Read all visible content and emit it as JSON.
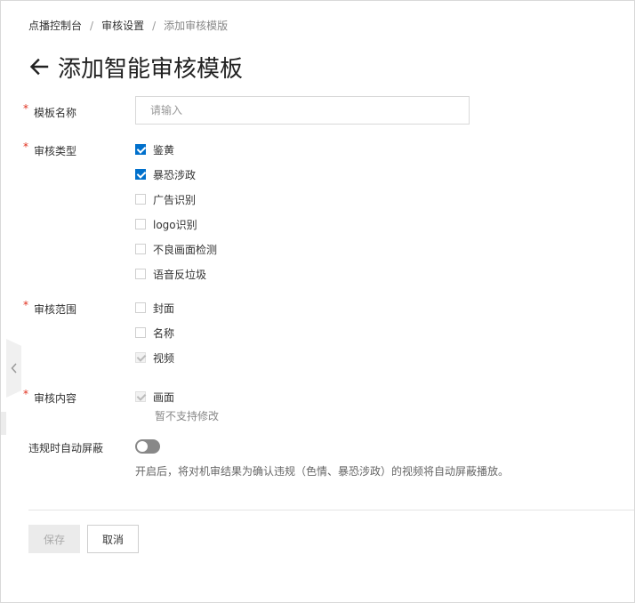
{
  "breadcrumb": {
    "items": [
      "点播控制台",
      "审核设置"
    ],
    "current": "添加审核模版",
    "separator": "/"
  },
  "page": {
    "title": "添加智能审核模板",
    "back_icon": "arrow-left-icon"
  },
  "form": {
    "required_mark": "*",
    "template_name": {
      "label": "模板名称",
      "placeholder": "请输入",
      "value": ""
    },
    "audit_type": {
      "label": "审核类型",
      "options": [
        {
          "label": "鉴黄",
          "checked": true
        },
        {
          "label": "暴恐涉政",
          "checked": true
        },
        {
          "label": "广告识别",
          "checked": false
        },
        {
          "label": "logo识别",
          "checked": false
        },
        {
          "label": "不良画面检测",
          "checked": false
        },
        {
          "label": "语音反垃圾",
          "checked": false
        }
      ]
    },
    "audit_scope": {
      "label": "审核范围",
      "options": [
        {
          "label": "封面",
          "checked": false
        },
        {
          "label": "名称",
          "checked": false
        },
        {
          "label": "视频",
          "checked": true,
          "disabled": true
        }
      ]
    },
    "audit_content": {
      "label": "审核内容",
      "options": [
        {
          "label": "画面",
          "checked": true,
          "disabled": true
        }
      ],
      "hint": "暂不支持修改"
    },
    "auto_block": {
      "label": "违规时自动屏蔽",
      "enabled": false,
      "description": "开启后，将对机审结果为确认违规（色情、暴恐涉政）的视频将自动屏蔽播放。"
    }
  },
  "actions": {
    "save_label": "保存",
    "cancel_label": "取消"
  },
  "colors": {
    "accent": "#0070cc",
    "required": "#e0301e",
    "toggle_off": "#888888"
  }
}
